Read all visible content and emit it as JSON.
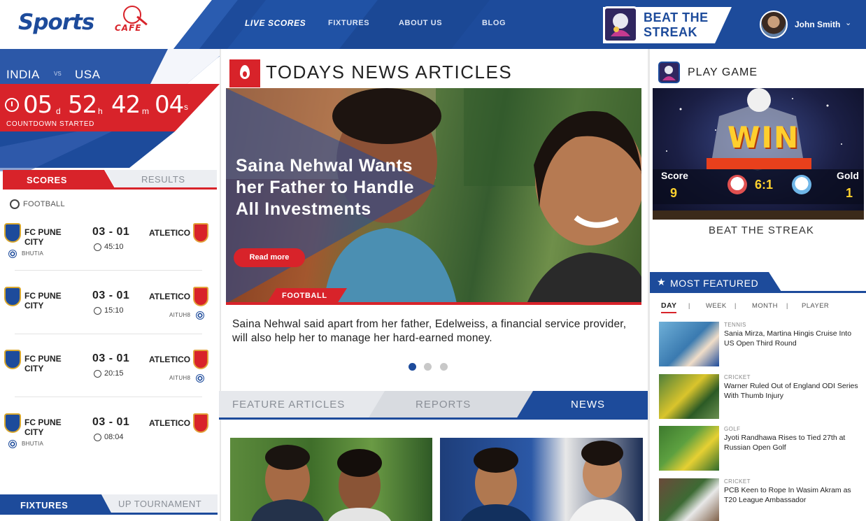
{
  "header": {
    "logo_main": "Sports",
    "logo_sub": "CAFE",
    "nav": [
      {
        "label": "LIVE SCORES",
        "active": true
      },
      {
        "label": "FIXTURES",
        "active": false
      },
      {
        "label": "ABOUT US",
        "active": false
      },
      {
        "label": "BLOG",
        "active": false
      }
    ],
    "promo_line1": "BEAT THE",
    "promo_line2": "STREAK",
    "user_name": "John Smith",
    "chevron": "⌄"
  },
  "match": {
    "team_a": "INDIA",
    "vs": "VS",
    "team_b": "USA",
    "countdown": {
      "days": "05",
      "d": "d",
      "hours": "52",
      "h": "h",
      "minutes": "42",
      "m": "m",
      "seconds": "04",
      "s": "s"
    },
    "countdown_label": "COUNTDOWN STARTED"
  },
  "scores_panel": {
    "tabs": [
      "SCORES",
      "RESULTS"
    ],
    "sport_label": "FOOTBALL",
    "matches": [
      {
        "home": "FC PUNE CITY",
        "score": "03 - 01",
        "time": "45:10",
        "away": "ATLETICO",
        "scorer": "BHUTIA",
        "scorer_side": "home"
      },
      {
        "home": "FC PUNE CITY",
        "score": "03 - 01",
        "time": "15:10",
        "away": "ATLETICO",
        "scorer": "AITUH8",
        "scorer_side": "away"
      },
      {
        "home": "FC PUNE CITY",
        "score": "03 - 01",
        "time": "20:15",
        "away": "ATLETICO",
        "scorer": "AITUH8",
        "scorer_side": "away"
      },
      {
        "home": "FC PUNE CITY",
        "score": "03 - 01",
        "time": "08:04",
        "away": "ATLETICO",
        "scorer": "BHUTIA",
        "scorer_side": "home"
      }
    ],
    "bottom_tabs": [
      "FIXTURES",
      "UP TOURNAMENT"
    ]
  },
  "news": {
    "section_title": "TODAYS NEWS ARTICLES",
    "hero_headline": "Saina Nehwal Wants her Father to Handle All Investments",
    "read_more": "Read more",
    "hero_tag": "FOOTBALL",
    "hero_desc": "Saina Nehwal said apart from her father, Edelweiss, a financial service provider, will also help her to manage her hard-earned money.",
    "slides": 3,
    "active_slide": 0,
    "tabs": [
      "FEATURE ARTICLES",
      "REPORTS",
      "NEWS"
    ],
    "active_tab": "NEWS"
  },
  "play_game": {
    "title": "PLAY GAME",
    "win_text": "WIN",
    "score_label": "Score",
    "score_value": "9",
    "result": "6:1",
    "gold_label": "Gold",
    "gold_value": "1",
    "caption": "BEAT THE STREAK"
  },
  "most_featured": {
    "title": "MOST FEATURED",
    "filters": [
      "DAY",
      "WEEK",
      "MONTH",
      "PLAYER"
    ],
    "separator": "|",
    "active_filter": "DAY",
    "articles": [
      {
        "category": "TENNIS",
        "title": "Sania Mirza, Martina Hingis Cruise Into US Open Third Round"
      },
      {
        "category": "CRICKET",
        "title": "Warner Ruled Out of England ODI Series With Thumb Injury"
      },
      {
        "category": "GOLF",
        "title": "Jyoti Randhawa Rises to Tied 27th at Russian Open Golf"
      },
      {
        "category": "CRICKET",
        "title": "PCB Keen to Rope In Wasim Akram as T20 League Ambassador"
      }
    ]
  },
  "colors": {
    "brand_blue": "#1d4b9b",
    "accent_red": "#d8232a",
    "gold": "#ffcf2e"
  },
  "icons": [
    "fire-icon",
    "clock-icon",
    "football-icon",
    "star-icon",
    "chevron-down-icon",
    "game-icon"
  ]
}
